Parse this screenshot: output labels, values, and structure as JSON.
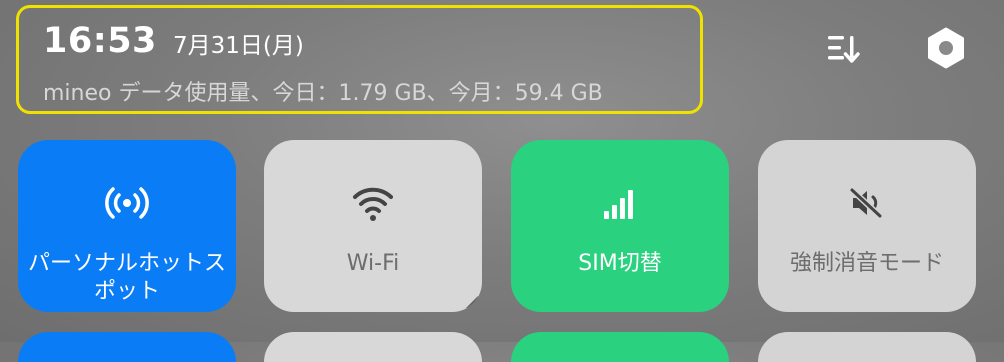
{
  "status": {
    "time": "16:53",
    "date": "7月31日(月)",
    "data_usage": "mineo データ使用量、今日：1.79 GB、今月：59.4 GB"
  },
  "header_actions": {
    "sort_icon": "sort-descending-icon",
    "settings_icon": "settings-hexagon-icon"
  },
  "tiles": [
    {
      "label": "パーソナルホットスポット",
      "icon": "hotspot-icon",
      "state": "on",
      "color": "#0a7cf6"
    },
    {
      "label": "Wi-Fi",
      "icon": "wifi-icon",
      "state": "off",
      "color": "#d8d8d8"
    },
    {
      "label": "SIM切替",
      "icon": "signal-bars-icon",
      "state": "on",
      "color": "#2ad17f"
    },
    {
      "label": "強制消音モード",
      "icon": "mute-speaker-icon",
      "state": "off",
      "color": "#d4d4d4"
    }
  ],
  "colors": {
    "highlight_border": "#f0e200",
    "tile_active_blue": "#0a7cf6",
    "tile_active_green": "#2ad17f",
    "tile_inactive": "#d8d8d8"
  }
}
